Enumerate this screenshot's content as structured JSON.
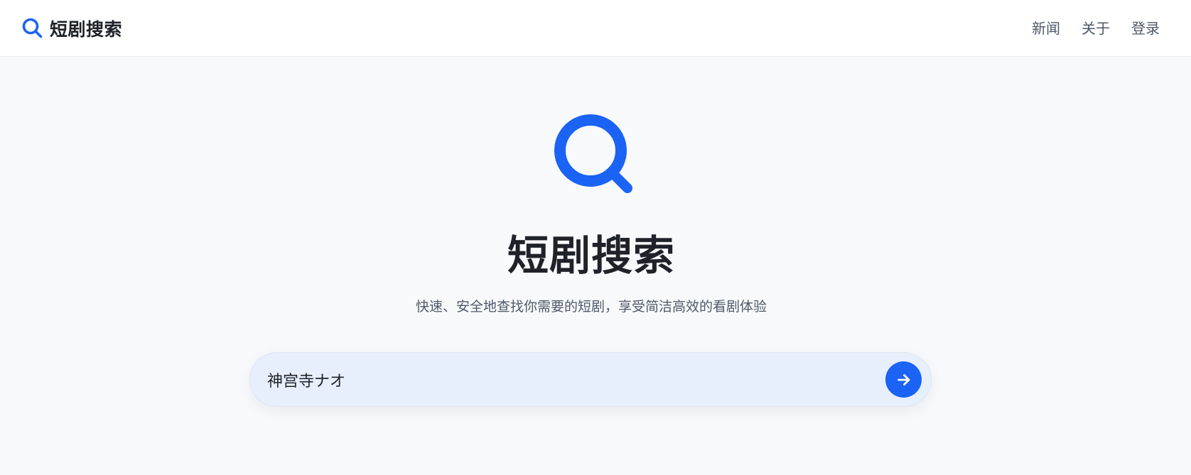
{
  "brand": {
    "name": "短剧搜索",
    "icon": "search-icon",
    "accent_color": "#1a63f5"
  },
  "nav": {
    "items": [
      {
        "label": "新闻"
      },
      {
        "label": "关于"
      },
      {
        "label": "登录"
      }
    ]
  },
  "hero": {
    "icon": "search-icon",
    "title": "短剧搜索",
    "subtitle": "快速、安全地查找你需要的短剧，享受简洁高效的看剧体验"
  },
  "search": {
    "value": "神宫寺ナオ",
    "button_icon": "arrow-right-icon"
  }
}
